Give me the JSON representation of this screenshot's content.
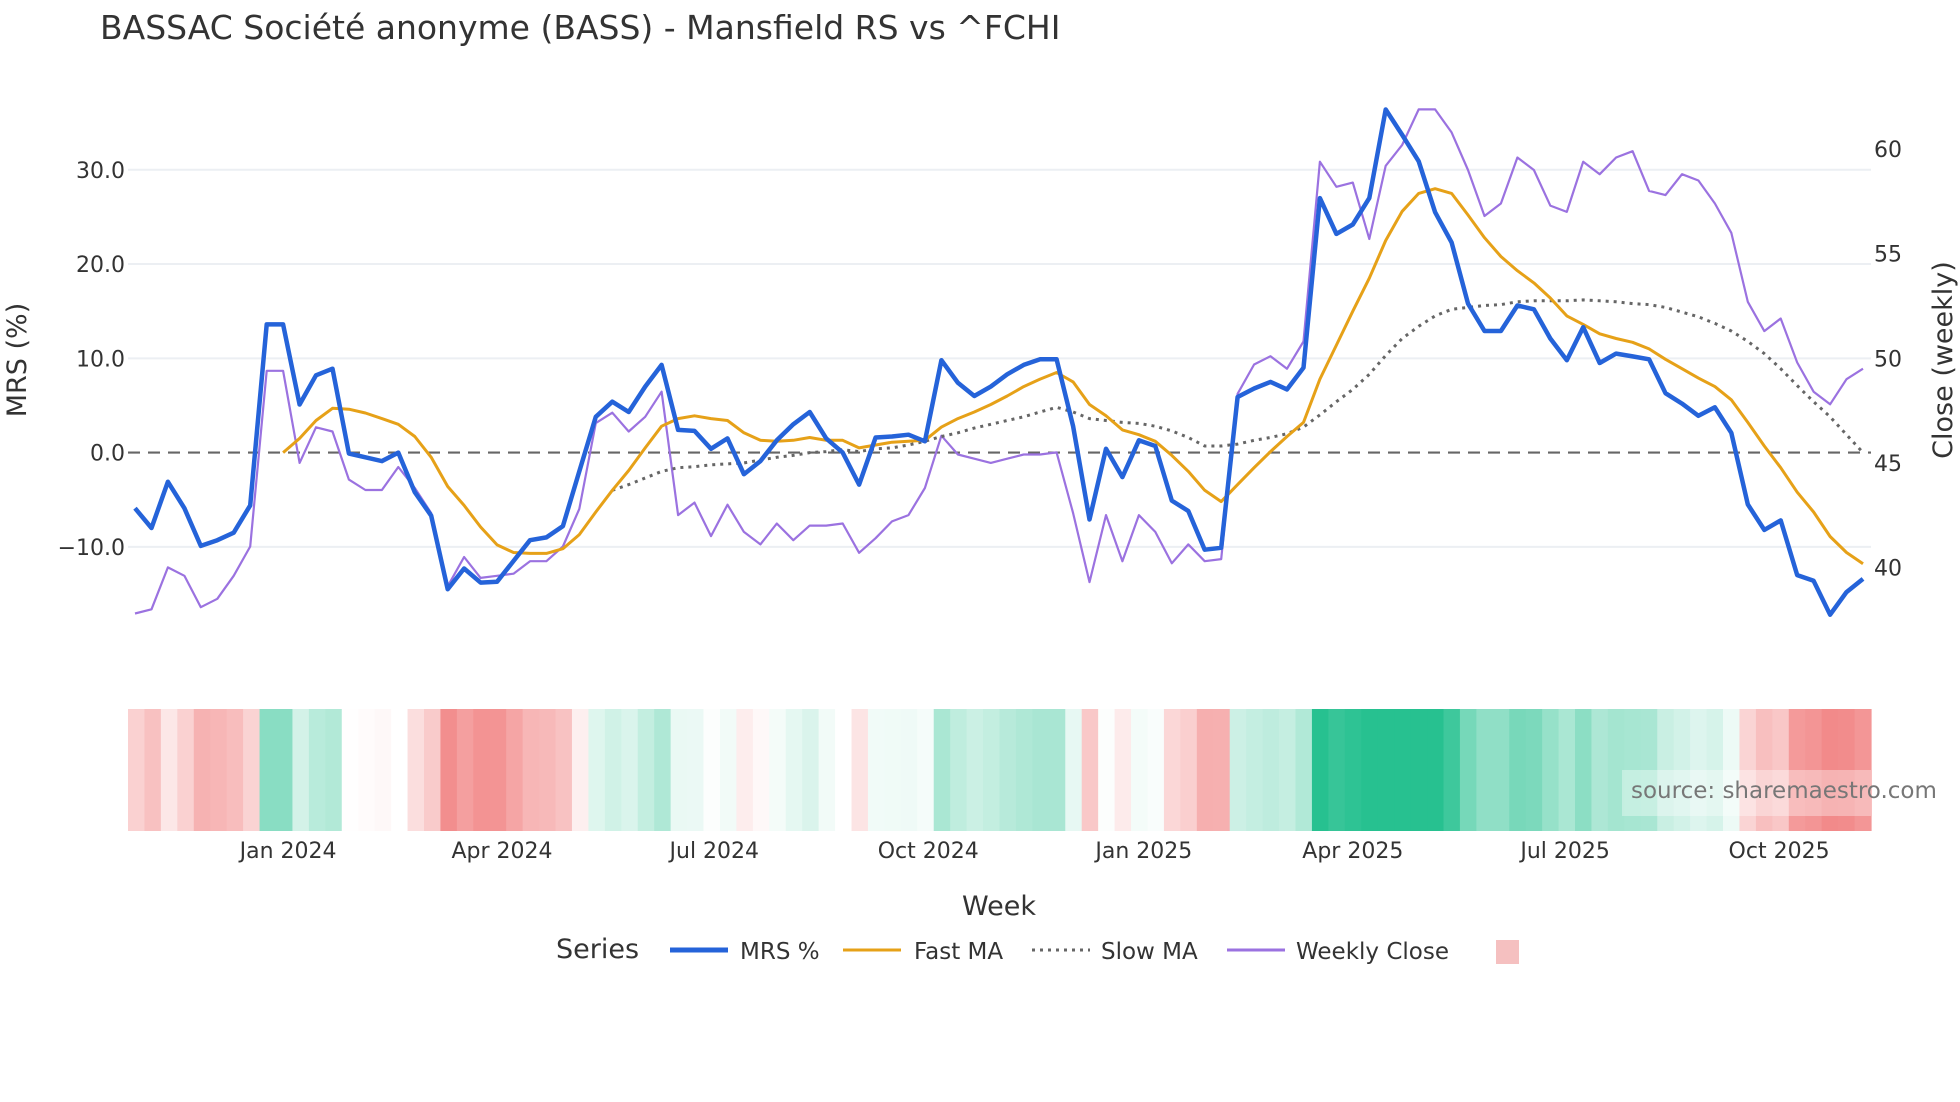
{
  "chart_data": {
    "type": "line",
    "title": "BASSAC Société anonyme (BASS) - Mansfield RS vs ^FCHI",
    "xlabel": "Week",
    "ylabel": "MRS (%)",
    "y2label": "Close (weekly)",
    "ylim": [
      -18.4,
      37.3
    ],
    "y2lim": [
      37.2,
      62.3
    ],
    "yticks": [
      -10,
      0,
      10,
      20,
      30
    ],
    "ytick_labels": [
      "−10.0",
      "0.0",
      "10.0",
      "20.0",
      "30.0"
    ],
    "y2ticks": [
      40,
      45,
      50,
      55,
      60
    ],
    "y2tick_labels": [
      "40",
      "45",
      "50",
      "55",
      "60"
    ],
    "xlim": [
      -0.4,
      105.4
    ],
    "xticks": [
      9.3,
      22.3,
      35.2,
      48.2,
      61.3,
      74.0,
      86.9,
      99.9
    ],
    "xtick_labels": [
      "Jan 2024",
      "Apr 2024",
      "Jul 2024",
      "Oct 2024",
      "Jan 2025",
      "Apr 2025",
      "Jul 2025",
      "Oct 2025"
    ],
    "grid": true,
    "zero_line": 0,
    "legend": {
      "title": "Series",
      "placement": "bottom-center"
    },
    "source": "source: sharemaestro.com",
    "series": [
      {
        "name": "MRS %",
        "axis": "left",
        "color": "#2563d9",
        "style": "solid",
        "start": 0,
        "values": [
          -5.9,
          -8,
          -3.1,
          -5.9,
          -9.9,
          -9.3,
          -8.5,
          -5.6,
          13.6,
          13.6,
          5.1,
          8.2,
          8.9,
          -0.1,
          -0.5,
          -0.9,
          0,
          -4.2,
          -6.7,
          -14.5,
          -12.3,
          -13.8,
          -13.7,
          -11.5,
          -9.3,
          -9,
          -7.8,
          -2,
          3.8,
          5.4,
          4.3,
          7,
          9.3,
          2.4,
          2.3,
          0.4,
          1.5,
          -2.3,
          -0.9,
          1.3,
          3,
          4.3,
          1.5,
          0,
          -3.4,
          1.6,
          1.7,
          1.9,
          1.2,
          9.8,
          7.4,
          6,
          7,
          8.3,
          9.3,
          9.9,
          9.9,
          2.8,
          -7.1,
          0.4,
          -2.6,
          1.3,
          0.7,
          -5.1,
          -6.2,
          -10.3,
          -10.1,
          5.9,
          6.8,
          7.5,
          6.7,
          9,
          27,
          23.2,
          24.2,
          27,
          36.4,
          33.7,
          30.9,
          25.5,
          22.3,
          15.8,
          12.9,
          12.9,
          15.6,
          15.2,
          12.1,
          9.8,
          13.3,
          9.5,
          10.5,
          10.2,
          9.9,
          6.3,
          5.2,
          3.9,
          4.8,
          2.1,
          -5.5,
          -8.2,
          -7.2,
          -13,
          -13.6,
          -17.2,
          -14.8,
          -13.4
        ]
      },
      {
        "name": "Fast MA",
        "axis": "left",
        "color": "#e6a118",
        "style": "solid",
        "start": 9,
        "values": [
          0,
          1.5,
          3.4,
          4.7,
          4.6,
          4.2,
          3.6,
          3,
          1.7,
          -0.5,
          -3.6,
          -5.6,
          -7.9,
          -9.8,
          -10.6,
          -10.7,
          -10.7,
          -10.2,
          -8.7,
          -6.3,
          -4,
          -1.9,
          0.5,
          2.8,
          3.6,
          3.9,
          3.6,
          3.4,
          2.1,
          1.3,
          1.2,
          1.3,
          1.6,
          1.3,
          1.3,
          0.5,
          0.8,
          1.1,
          1.2,
          1.3,
          2.7,
          3.6,
          4.3,
          5.1,
          6,
          7,
          7.8,
          8.5,
          7.5,
          5.1,
          3.9,
          2.4,
          1.9,
          1.2,
          -0.3,
          -2,
          -4,
          -5.2,
          -3.4,
          -1.6,
          0.1,
          1.7,
          3.2,
          7.8,
          11.4,
          15,
          18.5,
          22.5,
          25.6,
          27.5,
          28,
          27.5,
          25.2,
          22.8,
          20.8,
          19.3,
          18,
          16.4,
          14.5,
          13.6,
          12.6,
          12.1,
          11.7,
          11,
          9.9,
          8.9,
          7.9,
          7,
          5.6,
          3.2,
          0.7,
          -1.6,
          -4.2,
          -6.3,
          -8.9,
          -10.6,
          -11.8
        ]
      },
      {
        "name": "Slow MA",
        "axis": "left",
        "color": "#666666",
        "style": "dotted",
        "start": 29,
        "values": [
          -4,
          -3.4,
          -2.7,
          -2,
          -1.6,
          -1.5,
          -1.3,
          -1.2,
          -1.1,
          -0.8,
          -0.5,
          -0.3,
          0,
          0.1,
          0.3,
          0.1,
          0.4,
          0.5,
          0.8,
          1.2,
          1.7,
          2.1,
          2.6,
          3,
          3.4,
          3.8,
          4.3,
          4.8,
          4.3,
          3.6,
          3.4,
          3.2,
          3.1,
          2.8,
          2.3,
          1.6,
          0.7,
          0.7,
          0.9,
          1.3,
          1.6,
          2,
          2.7,
          4,
          5.4,
          6.7,
          8.3,
          10.3,
          12.1,
          13.4,
          14.5,
          15.2,
          15.4,
          15.6,
          15.7,
          16,
          16.1,
          16.1,
          16.1,
          16.2,
          16.1,
          16,
          15.8,
          15.7,
          15.4,
          14.9,
          14.4,
          13.7,
          12.9,
          11.8,
          10.5,
          8.9,
          7.1,
          5.4,
          3.8,
          1.9,
          0
        ]
      },
      {
        "name": "Weekly Close",
        "axis": "right",
        "color": "#9b72e0",
        "style": "solid",
        "start": 0,
        "values": [
          37.8,
          38,
          40,
          39.6,
          38.1,
          38.5,
          39.6,
          41,
          49.4,
          49.4,
          45,
          46.7,
          46.5,
          44.2,
          43.7,
          43.7,
          44.8,
          43.8,
          42.6,
          39.1,
          40.5,
          39.5,
          39.6,
          39.7,
          40.3,
          40.3,
          41,
          42.8,
          46.9,
          47.4,
          46.5,
          47.2,
          48.4,
          42.5,
          43.1,
          41.5,
          43,
          41.7,
          41.1,
          42.1,
          41.3,
          42,
          42,
          42.1,
          40.7,
          41.4,
          42.2,
          42.5,
          43.8,
          46.3,
          45.4,
          45.2,
          45,
          45.2,
          45.4,
          45.4,
          45.5,
          42.6,
          39.3,
          42.5,
          40.3,
          42.5,
          41.7,
          40.2,
          41.1,
          40.3,
          40.4,
          48.3,
          49.7,
          50.1,
          49.5,
          50.8,
          59.4,
          58.2,
          58.4,
          55.7,
          59.2,
          60.2,
          61.9,
          61.9,
          60.8,
          59,
          56.8,
          57.4,
          59.6,
          59,
          57.3,
          57,
          59.4,
          58.8,
          59.6,
          59.9,
          58,
          57.8,
          58.8,
          58.5,
          57.4,
          56,
          52.7,
          51.3,
          51.9,
          49.8,
          48.4,
          47.8,
          49,
          49.5
        ]
      }
    ],
    "heatmap": {
      "source_series": "MRS %",
      "negative_color": "#f28a8a",
      "neutral_color": "#ffffff",
      "positive_color": "#27c190",
      "neg_limit": -15,
      "pos_limit": 25
    },
    "legend_swatch_color": "#f5c0c0"
  }
}
